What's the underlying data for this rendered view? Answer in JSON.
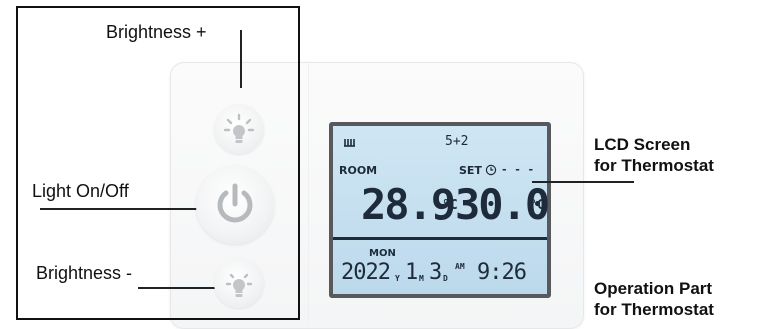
{
  "callouts": {
    "brightness_plus": "Brightness +",
    "light_on_off": "Light On/Off",
    "brightness_minus": "Brightness -",
    "lcd_screen_line1": "LCD Screen",
    "lcd_screen_line2": "for Thermostat",
    "operation_line1": "Operation Part",
    "operation_line2": "for Thermostat"
  },
  "lcd": {
    "program": "5+2",
    "room_label": "ROOM",
    "set_label": "SET",
    "set_indicator": "- - -",
    "room_temp": "28.9",
    "set_temp": "30.0",
    "unit": "°C",
    "day": "MON",
    "year": "2022",
    "year_suffix": "Y",
    "month": "1",
    "month_suffix": "M",
    "date": "3",
    "date_suffix": "D",
    "ampm": "AM",
    "time": "9:26"
  },
  "icons": {
    "brightness_plus": "lamp-bright-icon",
    "power": "power-icon",
    "brightness_minus": "lamp-dim-icon",
    "heating": "heating-icon",
    "clock": "clock-icon"
  },
  "colors": {
    "lcd_background": "#c6e0f1",
    "lcd_segments": "#1d2b3a",
    "icon_gray": "#bfc2c5"
  }
}
